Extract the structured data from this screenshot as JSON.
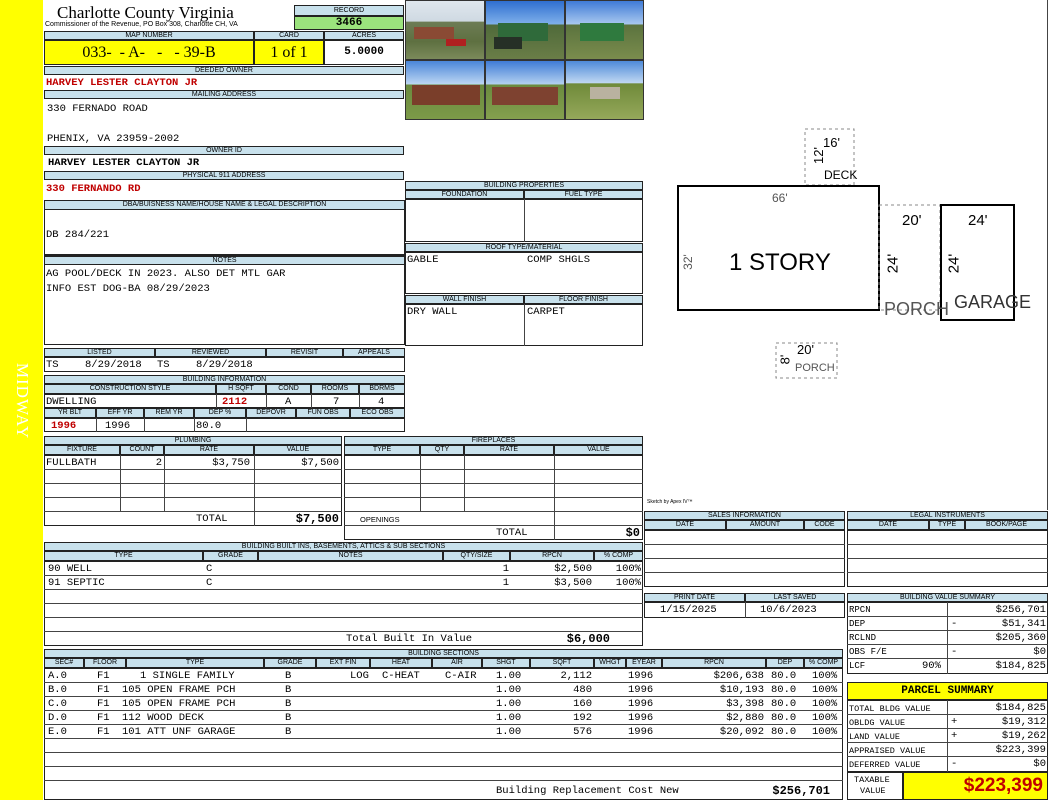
{
  "side_label": "MIDWAY",
  "header": {
    "county": "Charlotte County Virginia",
    "office": "Commissioner of the Revenue, PO Box 308, Charlotte CH, VA",
    "record_label": "RECORD",
    "record": "3466",
    "map_label": "MAP NUMBER",
    "map": "033-  - A-   -   - 39-B",
    "card_label": "CARD",
    "card": "1 of 1",
    "acres_label": "ACRES",
    "acres": "5.0000"
  },
  "owner": {
    "deeded_label": "DEEDED OWNER",
    "deeded": "HARVEY LESTER CLAYTON JR",
    "mailing_label": "MAILING ADDRESS",
    "addr1": "330 FERNADO ROAD",
    "addr2": "PHENIX, VA 23959-2002",
    "owner_id_label": "OWNER ID",
    "owner_id": "HARVEY LESTER CLAYTON JR",
    "physical_label": "PHYSICAL 911 ADDRESS",
    "physical": "330 FERNANDO RD"
  },
  "legal": {
    "label": "DBA/BUISNESS NAME/HOUSE NAME & LEGAL DESCRIPTION",
    "text": "DB 284/221"
  },
  "notes": {
    "label": "NOTES",
    "line1": "AG POOL/DECK IN 2023. ALSO DET MTL GAR",
    "line2": "INFO EST DOG-BA 08/29/2023"
  },
  "review": {
    "listed_label": "LISTED",
    "reviewed_label": "REVIEWED",
    "revisit_label": "REVISIT",
    "appeals_label": "APPEALS",
    "listed_by": "TS",
    "listed": "8/29/2018",
    "reviewed_by": "TS",
    "reviewed": "8/29/2018"
  },
  "building_info": {
    "label": "BUILDING INFORMATION",
    "style_label": "CONSTRUCTION STYLE",
    "hsqft_label": "H SQFT",
    "cond_label": "COND",
    "rooms_label": "ROOMS",
    "bdrms_label": "BDRMS",
    "style": "DWELLING",
    "hsqft": "2112",
    "cond": "A",
    "rooms": "7",
    "bdrms": "4",
    "yrblt_label": "YR BLT",
    "effyr_label": "EFF YR",
    "remyr_label": "REM YR",
    "dep_label": "DEP %",
    "depovr_label": "DEPOVR",
    "funobs_label": "FUN OBS",
    "ecoobs_label": "ECO OBS",
    "yrblt": "1996",
    "effyr": "1996",
    "dep": "80.0"
  },
  "props": {
    "label": "BUILDING PROPERTIES",
    "foundation_label": "FOUNDATION",
    "fuel_label": "FUEL TYPE",
    "roof_label": "ROOF TYPE/MATERIAL",
    "roof_type": "GABLE",
    "roof_mat": "COMP SHGLS",
    "wall_label": "WALL FINISH",
    "floor_label": "FLOOR FINISH",
    "wall": "DRY WALL",
    "floor": "CARPET"
  },
  "plumbing": {
    "label": "PLUMBING",
    "cols": [
      "FIXTURE",
      "COUNT",
      "RATE",
      "VALUE"
    ],
    "row": [
      "FULLBATH",
      "2",
      "$3,750",
      "$7,500"
    ],
    "total_label": "TOTAL",
    "total": "$7,500"
  },
  "fireplaces": {
    "label": "FIREPLACES",
    "cols": [
      "TYPE",
      "QTY",
      "RATE",
      "VALUE"
    ],
    "openings_label": "OPENINGS",
    "total_label": "TOTAL",
    "total": "$0"
  },
  "builtins": {
    "label": "BUILDING BUILT INS, BASEMENTS, ATTICS & SUB SECTIONS",
    "cols": [
      "TYPE",
      "GRADE",
      "NOTES",
      "QTY/SIZE",
      "RPCN",
      "% COMP"
    ],
    "rows": [
      [
        "90 WELL",
        "C",
        "1",
        "$2,500",
        "100%"
      ],
      [
        "91 SEPTIC",
        "C",
        "1",
        "$3,500",
        "100%"
      ]
    ],
    "total_label": "Total Built In Value",
    "total": "$6,000"
  },
  "sections": {
    "label": "BUILDING SECTIONS",
    "cols": [
      "SEC#",
      "FLOOR",
      "TYPE",
      "GRADE",
      "EXT FIN",
      "HEAT",
      "AIR",
      "SHGT",
      "SQFT",
      "WHGT",
      "EYEAR",
      "RPCN",
      "DEP",
      "% COMP"
    ],
    "rows": [
      {
        "sec": "A.0",
        "floor": "F1",
        "type": "1 SINGLE FAMILY",
        "grade": "B",
        "ext": "LOG",
        "heat": "C-HEAT",
        "air": "C-AIR",
        "shgt": "1.00",
        "sqft": "2,112",
        "eyear": "1996",
        "rpcn": "$206,638",
        "dep": "80.0",
        "comp": "100%"
      },
      {
        "sec": "B.0",
        "floor": "F1",
        "type": "105 OPEN FRAME PCH",
        "grade": "B",
        "ext": "",
        "heat": "",
        "air": "",
        "shgt": "1.00",
        "sqft": "480",
        "eyear": "1996",
        "rpcn": "$10,193",
        "dep": "80.0",
        "comp": "100%"
      },
      {
        "sec": "C.0",
        "floor": "F1",
        "type": "105 OPEN FRAME PCH",
        "grade": "B",
        "ext": "",
        "heat": "",
        "air": "",
        "shgt": "1.00",
        "sqft": "160",
        "eyear": "1996",
        "rpcn": "$3,398",
        "dep": "80.0",
        "comp": "100%"
      },
      {
        "sec": "D.0",
        "floor": "F1",
        "type": "112 WOOD DECK",
        "grade": "B",
        "ext": "",
        "heat": "",
        "air": "",
        "shgt": "1.00",
        "sqft": "192",
        "eyear": "1996",
        "rpcn": "$2,880",
        "dep": "80.0",
        "comp": "100%"
      },
      {
        "sec": "E.0",
        "floor": "F1",
        "type": "101 ATT UNF GARAGE",
        "grade": "B",
        "ext": "",
        "heat": "",
        "air": "",
        "shgt": "1.00",
        "sqft": "576",
        "eyear": "1996",
        "rpcn": "$20,092",
        "dep": "80.0",
        "comp": "100%"
      }
    ],
    "cost_label": "Building Replacement Cost New",
    "cost": "$256,701"
  },
  "sketch": {
    "deck": "DECK",
    "deck_w": "16'",
    "deck_h": "12'",
    "house": "1 STORY",
    "house_w": "66'",
    "house_h": "32'",
    "porch": "PORCH",
    "porch_w": "20'",
    "porch_h": "24'",
    "garage": "GARAGE",
    "garage_w": "24'",
    "garage_h": "24'",
    "porch2": "PORCH",
    "porch2_w": "20'",
    "porch2_h": "8'",
    "credit": "Sketch by Apex IV™"
  },
  "sales": {
    "label": "SALES INFORMATION",
    "cols": [
      "DATE",
      "AMOUNT",
      "CODE"
    ]
  },
  "instruments": {
    "label": "LEGAL INSTRUMENTS",
    "cols": [
      "DATE",
      "TYPE",
      "BOOK/PAGE"
    ]
  },
  "print": {
    "print_label": "PRINT DATE",
    "saved_label": "LAST SAVED",
    "print_date": "1/15/2025",
    "saved": "10/6/2023"
  },
  "value_summary": {
    "label": "BUILDING VALUE SUMMARY",
    "rpcn_label": "RPCN",
    "rpcn": "$256,701",
    "dep_label": "DEP",
    "dep_sign": "-",
    "dep": "$51,341",
    "rclnd_label": "RCLND",
    "rclnd": "$205,360",
    "obs_label": "OBS F/E",
    "obs_sign": "-",
    "obs": "$0",
    "lcf_label": "LCF",
    "lcf_pct": "90%",
    "lcf": "$184,825"
  },
  "parcel": {
    "label": "PARCEL SUMMARY",
    "bldg_label": "TOTAL BLDG VALUE",
    "bldg": "$184,825",
    "obldg_label": "OBLDG VALUE",
    "obldg_sign": "+",
    "obldg": "$19,312",
    "land_label": "LAND VALUE",
    "land_sign": "+",
    "land": "$19,262",
    "appraised_label": "APPRAISED VALUE",
    "appraised": "$223,399",
    "deferred_label": "DEFERRED VALUE",
    "deferred_sign": "-",
    "deferred": "$0",
    "taxable_label1": "TAXABLE",
    "taxable_label2": "VALUE",
    "taxable": "$223,399"
  },
  "colors": {
    "yellow": "#ffff00",
    "label_bg": "#c8e1ec",
    "record_bg": "#9be37d",
    "red": "#c00000"
  }
}
